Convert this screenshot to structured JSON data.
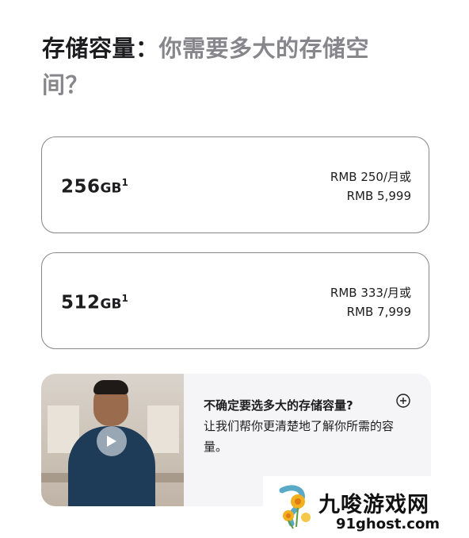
{
  "heading": {
    "lead": "存储容量：",
    "rest": "你需要多大的存储空间？"
  },
  "options": [
    {
      "capacity": "256",
      "unit": "GB",
      "footnote": "1",
      "monthly": "RMB 250/月或",
      "full": "RMB 5,999"
    },
    {
      "capacity": "512",
      "unit": "GB",
      "footnote": "1",
      "monthly": "RMB 333/月或",
      "full": "RMB 7,999"
    }
  ],
  "help": {
    "question": "不确定要选多大的存储容量?",
    "description": "让我们帮你更清楚地了解你所需的容量。",
    "video_icon": "play-icon",
    "expand_icon": "plus-circle-icon"
  },
  "watermark": {
    "title": "九唆游戏网",
    "url": "91ghost.com"
  },
  "colors": {
    "text": "#1d1d1f",
    "secondary": "#86868b",
    "card_border": "#86868b",
    "help_bg": "#f5f5f7"
  }
}
